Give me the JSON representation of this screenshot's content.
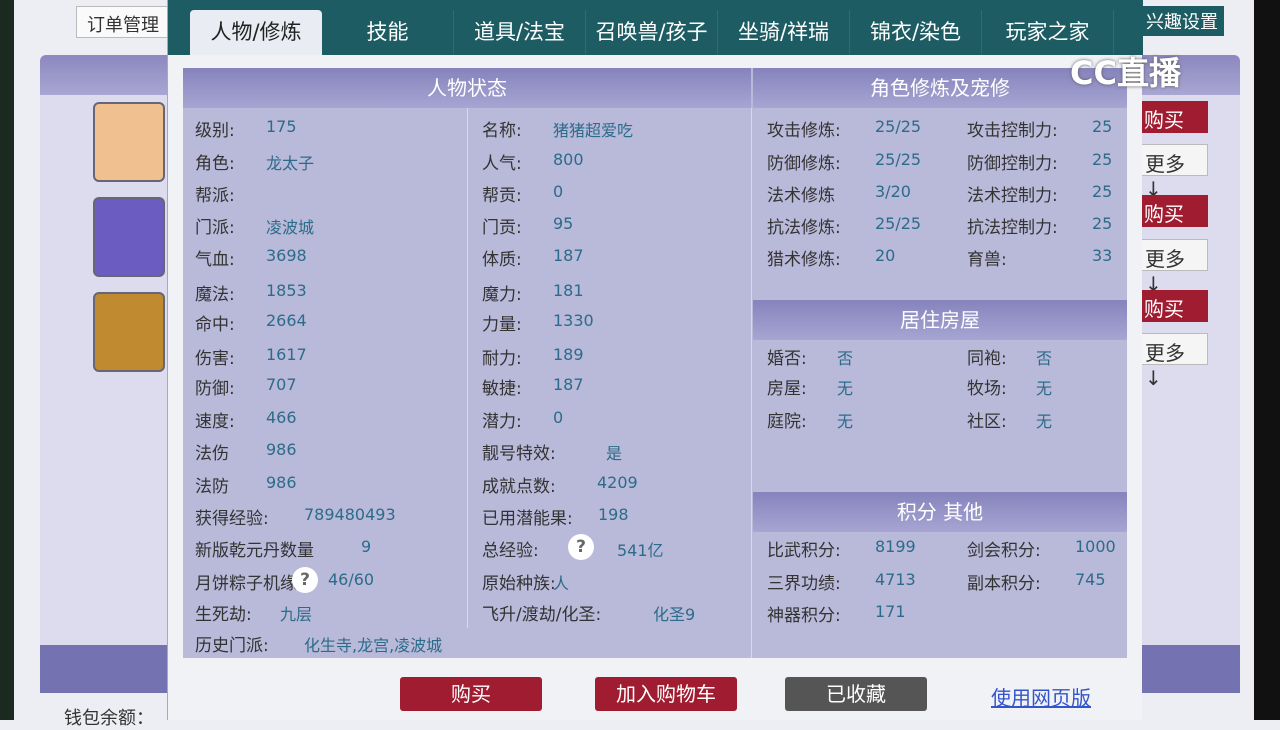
{
  "background": {
    "order_label": "订单管理",
    "wallet_label": "钱包余额：",
    "buy": "购买",
    "more": "更多↓",
    "watermark": "CC直播",
    "interest": "兴趣设置"
  },
  "tabs": [
    "人物/修炼",
    "技能",
    "道具/法宝",
    "召唤兽/孩子",
    "坐骑/祥瑞",
    "锦衣/染色",
    "玩家之家"
  ],
  "status": {
    "title": "人物状态",
    "rows": [
      {
        "label": "级别:",
        "value": "175"
      },
      {
        "label": "名称:",
        "value": "猪猪超爱吃"
      },
      {
        "label": "角色:",
        "value": "龙太子"
      },
      {
        "label": "人气:",
        "value": "800"
      },
      {
        "label": "帮派:",
        "value": ""
      },
      {
        "label": "帮贡:",
        "value": "0"
      },
      {
        "label": "门派:",
        "value": "凌波城"
      },
      {
        "label": "门贡:",
        "value": "95"
      },
      {
        "label": "气血:",
        "value": "3698"
      },
      {
        "label": "体质:",
        "value": "187"
      },
      {
        "label": "魔法:",
        "value": "1853"
      },
      {
        "label": "魔力:",
        "value": "181"
      },
      {
        "label": "命中:",
        "value": "2664"
      },
      {
        "label": "力量:",
        "value": "1330"
      },
      {
        "label": "伤害:",
        "value": "1617"
      },
      {
        "label": "耐力:",
        "value": "189"
      },
      {
        "label": "防御:",
        "value": "707"
      },
      {
        "label": "敏捷:",
        "value": "187"
      },
      {
        "label": "速度:",
        "value": "466"
      },
      {
        "label": "潜力:",
        "value": "0"
      },
      {
        "label": "法伤",
        "value": "986"
      },
      {
        "label": "靓号特效:",
        "value": "是"
      },
      {
        "label": "法防",
        "value": "986"
      },
      {
        "label": "成就点数:",
        "value": "4209"
      },
      {
        "label": "获得经验:",
        "value": "789480493"
      },
      {
        "label": "已用潜能果:",
        "value": "198"
      },
      {
        "label": "新版乾元丹数量",
        "value": "9"
      },
      {
        "label": "总经验:",
        "value": "541亿",
        "help": "?"
      },
      {
        "label": "月饼粽子机缘:",
        "value": "46/60",
        "help": "?"
      },
      {
        "label": "原始种族:",
        "value": "人"
      },
      {
        "label": "生死劫:",
        "value": "九层"
      },
      {
        "label": "飞升/渡劫/化圣:",
        "value": "化圣9"
      },
      {
        "label": "历史门派:",
        "value": "化生寺,龙宫,凌波城"
      }
    ]
  },
  "cultivation": {
    "title": "角色修炼及宠修",
    "rows": [
      {
        "label": "攻击修炼:",
        "value": "25/25"
      },
      {
        "label": "攻击控制力:",
        "value": "25"
      },
      {
        "label": "防御修炼:",
        "value": "25/25"
      },
      {
        "label": "防御控制力:",
        "value": "25"
      },
      {
        "label": "法术修炼",
        "value": "3/20"
      },
      {
        "label": "法术控制力:",
        "value": "25"
      },
      {
        "label": "抗法修炼:",
        "value": "25/25"
      },
      {
        "label": "抗法控制力:",
        "value": "25"
      },
      {
        "label": "猎术修炼:",
        "value": "20"
      },
      {
        "label": "育兽:",
        "value": "33"
      }
    ]
  },
  "housing": {
    "title": "居住房屋",
    "rows": [
      {
        "label": "婚否:",
        "value": "否"
      },
      {
        "label": "同袍:",
        "value": "否"
      },
      {
        "label": "房屋:",
        "value": "无"
      },
      {
        "label": "牧场:",
        "value": "无"
      },
      {
        "label": "庭院:",
        "value": "无"
      },
      {
        "label": "社区:",
        "value": "无"
      }
    ]
  },
  "points": {
    "title": "积分 其他",
    "rows": [
      {
        "label": "比武积分:",
        "value": "8199"
      },
      {
        "label": "剑会积分:",
        "value": "1000"
      },
      {
        "label": "三界功绩:",
        "value": "4713"
      },
      {
        "label": "副本积分:",
        "value": "745"
      },
      {
        "label": "神器积分:",
        "value": "171"
      }
    ]
  },
  "actions": {
    "buy": "购买",
    "add_cart": "加入购物车",
    "favorited": "已收藏",
    "web": "使用网页版"
  },
  "colors": {
    "tab_bar": "#1d5c63",
    "header": "#8683bd",
    "buy": "#a01c30",
    "favorited": "#555555"
  }
}
